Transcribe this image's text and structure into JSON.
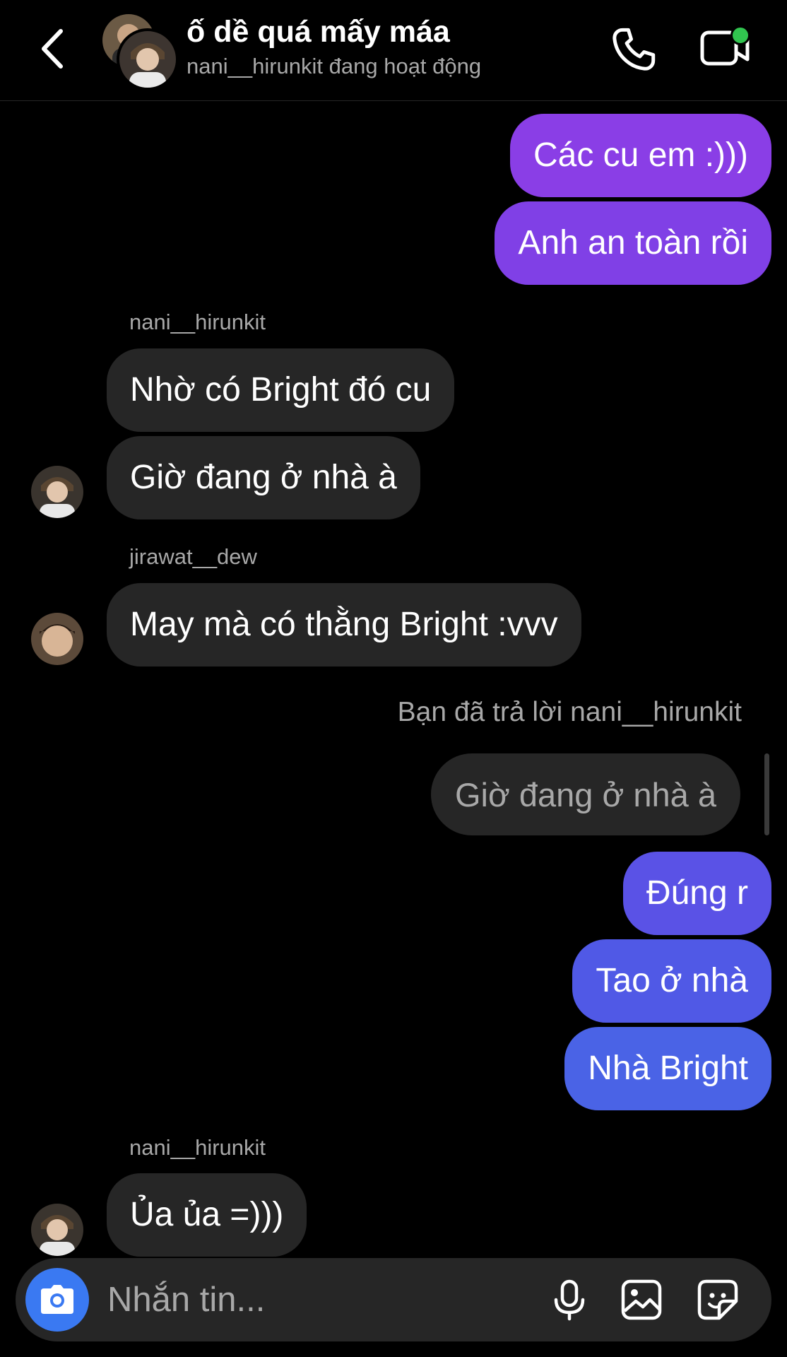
{
  "header": {
    "title": "ố dề quá mấy máa",
    "subtitle": "nani__hirunkit đang hoạt động"
  },
  "messages": {
    "sent_1": "Các cu em :)))",
    "sent_2": "Anh an toàn rồi",
    "sender_1": "nani__hirunkit",
    "recv_1": "Nhờ có Bright đó cu",
    "recv_2": "Giờ đang ở nhà à",
    "sender_2": "jirawat__dew",
    "recv_3": "May mà có thằng Bright :vvv",
    "reply_note": "Bạn đã trả lời nani__hirunkit",
    "quoted": "Giờ đang ở nhà à",
    "sent_3": "Đúng r",
    "sent_4": "Tao ở nhà",
    "sent_5": "Nhà Bright",
    "sender_3": "nani__hirunkit",
    "recv_4": "Ủa ủa =)))"
  },
  "composer": {
    "placeholder": "Nhắn tin..."
  },
  "colors": {
    "sent_purple": "#8a3ee6",
    "sent_blue": "#4a63e6",
    "received_bg": "#262626",
    "online_dot": "#31c44f",
    "camera_btn": "#3a79f2"
  },
  "icons": [
    "back-icon",
    "phone-icon",
    "video-camera-icon",
    "camera-icon",
    "microphone-icon",
    "image-icon",
    "sticker-icon"
  ]
}
